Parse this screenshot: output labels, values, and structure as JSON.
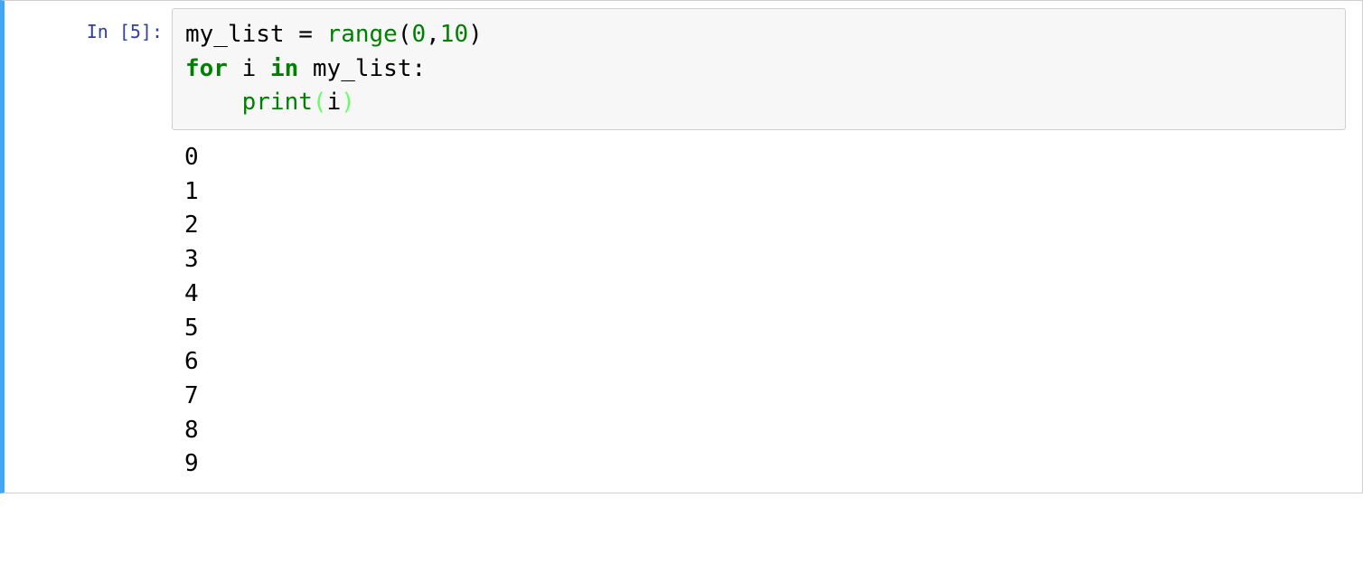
{
  "cell": {
    "prompt": "In [5]:",
    "code": {
      "line1": {
        "var1": "my_list",
        "eq": " = ",
        "fn": "range",
        "lp": "(",
        "n0": "0",
        "comma": ",",
        "n1": "10",
        "rp": ")"
      },
      "line2": {
        "kw_for": "for",
        "sp1": " ",
        "var_i": "i",
        "sp2": " ",
        "kw_in": "in",
        "sp3": " ",
        "var_list": "my_list",
        "colon": ":"
      },
      "line3": {
        "indent": "    ",
        "fn": "print",
        "lp": "(",
        "arg": "i",
        "rp": ")"
      }
    },
    "output_lines": [
      "0",
      "1",
      "2",
      "3",
      "4",
      "5",
      "6",
      "7",
      "8",
      "9"
    ]
  }
}
